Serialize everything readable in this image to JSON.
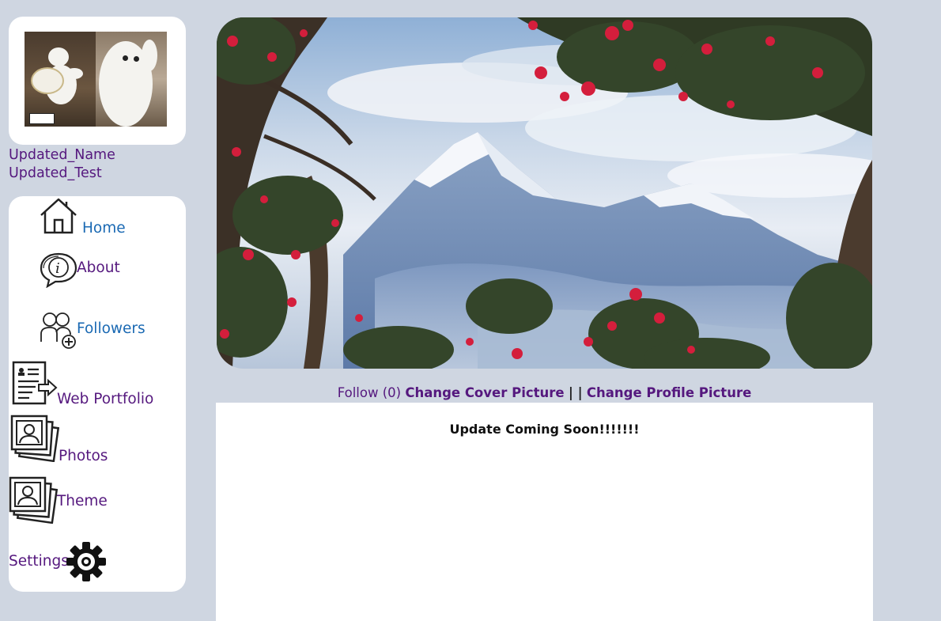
{
  "profile": {
    "first_name": "Updated_Name",
    "last_name": "Updated_Test",
    "avatar_alt": "profile picture"
  },
  "nav": {
    "home": "Home",
    "about": "About",
    "followers": "Followers",
    "portfolio": "Web Portfolio",
    "photos": "Photos",
    "theme": "Theme",
    "settings": "Settings"
  },
  "cover": {
    "alt": "cover picture"
  },
  "actions": {
    "follow": "Follow (0)",
    "change_cover": "Change Cover Picture",
    "separator": "| |",
    "change_profile": "Change Profile Picture"
  },
  "content": {
    "message": "Update Coming Soon!!!!!!!"
  },
  "colors": {
    "page_bg": "#cfd6e1",
    "link_purple": "#55187e",
    "link_blue": "#1a69b3"
  }
}
